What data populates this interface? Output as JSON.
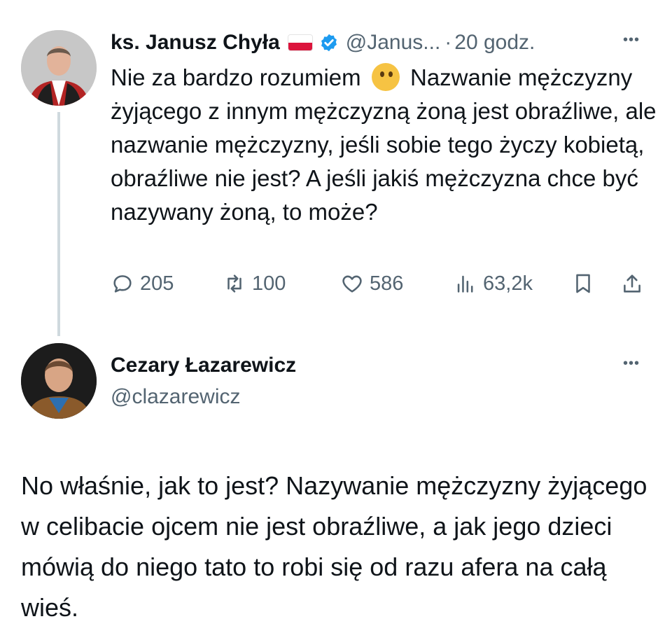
{
  "tweet1": {
    "author_name": "ks. Janusz Chyła",
    "handle": "@Janus...",
    "separator": "·",
    "time": "20 godz.",
    "more": "•••",
    "text_before_emoji": "Nie za bardzo rozumiem",
    "emoji_icon": "thinking-face-emoji",
    "text_after_emoji": "Nazwanie mężczyzny żyjącego z innym mężczyzną żoną jest obraźliwe, ale nazwanie mężczyzny, jeśli sobie tego życzy kobietą, obraźliwe nie jest? A jeśli jakiś mężczyzna chce być nazywany żoną, to może?",
    "stats": {
      "replies": "205",
      "retweets": "100",
      "likes": "586",
      "views": "63,2k"
    }
  },
  "tweet2": {
    "author_name": "Cezary Łazarewicz",
    "handle": "@clazarewicz",
    "more": "•••",
    "text": "No właśnie, jak to jest? Nazywanie mężczyzny żyjącego w celibacie ojcem nie jest obraźliwe, a jak jego dzieci mówią do niego tato to robi się od razu afera na całą wieś."
  },
  "colors": {
    "text": "#0f1419",
    "secondary": "#536471",
    "verified": "#1d9bf0",
    "thread_line": "#cfd9de"
  }
}
